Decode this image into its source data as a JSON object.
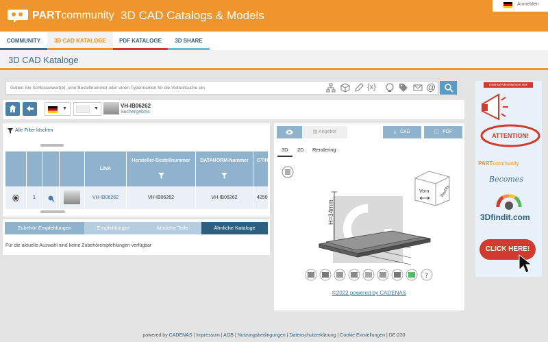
{
  "header": {
    "brand_bold": "PART",
    "brand_light": "community",
    "subtitle": "3D CAD Catalogs & Models",
    "login": "Anmelden"
  },
  "nav": {
    "tabs": [
      {
        "label": "COMMUNITY",
        "color": "#3a6c8e"
      },
      {
        "label": "3D CAD KATALOGE",
        "color": "#f0952c",
        "active": true
      },
      {
        "label": "PDF KATALOGE",
        "color": "#d23a2e"
      },
      {
        "label": "3D SHARE",
        "color": "#6fb5e0"
      }
    ]
  },
  "page_title": "3D CAD Kataloge",
  "search": {
    "placeholder": "Geben Sie Schlüsselwort(e), eine Bestellnummer oder einen Typennamen für die Volltextsuche ein",
    "icons": [
      "hierarchy-icon",
      "cube-icon",
      "pencil-icon",
      "variable-icon",
      "bulb-search-icon",
      "tags-icon",
      "mail-icon",
      "at-icon",
      "search-icon"
    ]
  },
  "product": {
    "name": "VH-IB06262",
    "sub": "Suchergebnis"
  },
  "filter": {
    "clear_label": "Alle Filter löschen"
  },
  "table": {
    "headers": [
      "LINA",
      "Hersteller-Bestellnummer",
      "DATANORM-Nummer",
      "GTIN"
    ],
    "row": {
      "index": "1",
      "lina": "VH-IB06262",
      "order": "VH-IB06262",
      "datanorm": "VH-IB06262",
      "gtin": "4250"
    }
  },
  "lower_tabs": [
    "Zubehör Empfehlungen",
    "Empfehlungen",
    "Ähnliche Teile",
    "Ähnliche Kataloge"
  ],
  "lower_text": "Für die aktuelle Auswahl sind keine Zubehörempfehlungen verfügbar",
  "viewer": {
    "buttons": {
      "offer": "Angebot",
      "cad": "CAD",
      "pdf": "PDF"
    },
    "view_tabs": [
      "3D",
      "2D",
      "Rendering"
    ],
    "dimension_label": "H=34mm",
    "cube_front": "Vorn",
    "cube_right": "Rechts",
    "copyright": "©2022 powered by CADENAS"
  },
  "ad": {
    "label": "External Advertisement Link",
    "attention": "ATTENTION!",
    "pc_bold": "PART",
    "pc_light": "community",
    "becomes": "Becomes",
    "findit": "3Dfindit.com",
    "click": "CLICK HERE!"
  },
  "footer": {
    "prefix": "powered by",
    "cadenas": "CADENAS",
    "links": [
      "Impressum",
      "AGB",
      "Nutzungsbedingungen",
      "Datenschutzerklärung",
      "Cookie Einstellungen"
    ],
    "locale": "DE-230"
  },
  "colors": {
    "accent": "#f0952c",
    "blue": "#4a80a8",
    "red": "#d23a2e"
  }
}
